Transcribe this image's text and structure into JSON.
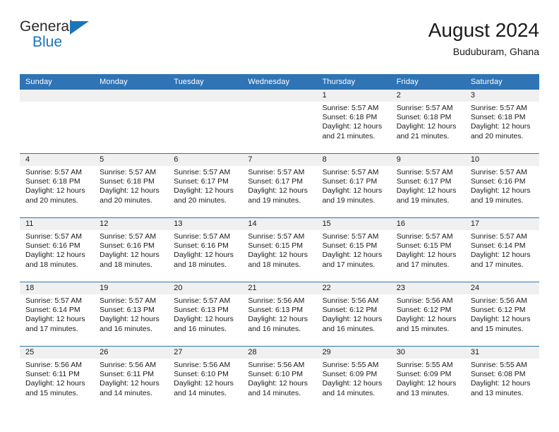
{
  "brand": {
    "name_part1": "General",
    "name_part2": "Blue",
    "flag_icon": "blue-triangle-flag",
    "colors": {
      "text": "#2b2b2b",
      "accent": "#1b75bb"
    }
  },
  "header": {
    "title": "August 2024",
    "subtitle": "Buduburam, Ghana"
  },
  "theme": {
    "header_blue": "#2f74b5",
    "daynum_band": "#f0f0f0",
    "cell_background": "#ffffff",
    "text": "#1a1a1a"
  },
  "calendar": {
    "weekday_headers": [
      "Sunday",
      "Monday",
      "Tuesday",
      "Wednesday",
      "Thursday",
      "Friday",
      "Saturday"
    ],
    "weeks": [
      [
        {
          "day": "",
          "empty": true,
          "sunrise": "",
          "sunset": "",
          "daylight_line1": "",
          "daylight_line2": ""
        },
        {
          "day": "",
          "empty": true,
          "sunrise": "",
          "sunset": "",
          "daylight_line1": "",
          "daylight_line2": ""
        },
        {
          "day": "",
          "empty": true,
          "sunrise": "",
          "sunset": "",
          "daylight_line1": "",
          "daylight_line2": ""
        },
        {
          "day": "",
          "empty": true,
          "sunrise": "",
          "sunset": "",
          "daylight_line1": "",
          "daylight_line2": ""
        },
        {
          "day": "1",
          "empty": false,
          "sunrise": "Sunrise: 5:57 AM",
          "sunset": "Sunset: 6:18 PM",
          "daylight_line1": "Daylight: 12 hours",
          "daylight_line2": "and 21 minutes."
        },
        {
          "day": "2",
          "empty": false,
          "sunrise": "Sunrise: 5:57 AM",
          "sunset": "Sunset: 6:18 PM",
          "daylight_line1": "Daylight: 12 hours",
          "daylight_line2": "and 21 minutes."
        },
        {
          "day": "3",
          "empty": false,
          "sunrise": "Sunrise: 5:57 AM",
          "sunset": "Sunset: 6:18 PM",
          "daylight_line1": "Daylight: 12 hours",
          "daylight_line2": "and 20 minutes."
        }
      ],
      [
        {
          "day": "4",
          "empty": false,
          "sunrise": "Sunrise: 5:57 AM",
          "sunset": "Sunset: 6:18 PM",
          "daylight_line1": "Daylight: 12 hours",
          "daylight_line2": "and 20 minutes."
        },
        {
          "day": "5",
          "empty": false,
          "sunrise": "Sunrise: 5:57 AM",
          "sunset": "Sunset: 6:18 PM",
          "daylight_line1": "Daylight: 12 hours",
          "daylight_line2": "and 20 minutes."
        },
        {
          "day": "6",
          "empty": false,
          "sunrise": "Sunrise: 5:57 AM",
          "sunset": "Sunset: 6:17 PM",
          "daylight_line1": "Daylight: 12 hours",
          "daylight_line2": "and 20 minutes."
        },
        {
          "day": "7",
          "empty": false,
          "sunrise": "Sunrise: 5:57 AM",
          "sunset": "Sunset: 6:17 PM",
          "daylight_line1": "Daylight: 12 hours",
          "daylight_line2": "and 19 minutes."
        },
        {
          "day": "8",
          "empty": false,
          "sunrise": "Sunrise: 5:57 AM",
          "sunset": "Sunset: 6:17 PM",
          "daylight_line1": "Daylight: 12 hours",
          "daylight_line2": "and 19 minutes."
        },
        {
          "day": "9",
          "empty": false,
          "sunrise": "Sunrise: 5:57 AM",
          "sunset": "Sunset: 6:17 PM",
          "daylight_line1": "Daylight: 12 hours",
          "daylight_line2": "and 19 minutes."
        },
        {
          "day": "10",
          "empty": false,
          "sunrise": "Sunrise: 5:57 AM",
          "sunset": "Sunset: 6:16 PM",
          "daylight_line1": "Daylight: 12 hours",
          "daylight_line2": "and 19 minutes."
        }
      ],
      [
        {
          "day": "11",
          "empty": false,
          "sunrise": "Sunrise: 5:57 AM",
          "sunset": "Sunset: 6:16 PM",
          "daylight_line1": "Daylight: 12 hours",
          "daylight_line2": "and 18 minutes."
        },
        {
          "day": "12",
          "empty": false,
          "sunrise": "Sunrise: 5:57 AM",
          "sunset": "Sunset: 6:16 PM",
          "daylight_line1": "Daylight: 12 hours",
          "daylight_line2": "and 18 minutes."
        },
        {
          "day": "13",
          "empty": false,
          "sunrise": "Sunrise: 5:57 AM",
          "sunset": "Sunset: 6:16 PM",
          "daylight_line1": "Daylight: 12 hours",
          "daylight_line2": "and 18 minutes."
        },
        {
          "day": "14",
          "empty": false,
          "sunrise": "Sunrise: 5:57 AM",
          "sunset": "Sunset: 6:15 PM",
          "daylight_line1": "Daylight: 12 hours",
          "daylight_line2": "and 18 minutes."
        },
        {
          "day": "15",
          "empty": false,
          "sunrise": "Sunrise: 5:57 AM",
          "sunset": "Sunset: 6:15 PM",
          "daylight_line1": "Daylight: 12 hours",
          "daylight_line2": "and 17 minutes."
        },
        {
          "day": "16",
          "empty": false,
          "sunrise": "Sunrise: 5:57 AM",
          "sunset": "Sunset: 6:15 PM",
          "daylight_line1": "Daylight: 12 hours",
          "daylight_line2": "and 17 minutes."
        },
        {
          "day": "17",
          "empty": false,
          "sunrise": "Sunrise: 5:57 AM",
          "sunset": "Sunset: 6:14 PM",
          "daylight_line1": "Daylight: 12 hours",
          "daylight_line2": "and 17 minutes."
        }
      ],
      [
        {
          "day": "18",
          "empty": false,
          "sunrise": "Sunrise: 5:57 AM",
          "sunset": "Sunset: 6:14 PM",
          "daylight_line1": "Daylight: 12 hours",
          "daylight_line2": "and 17 minutes."
        },
        {
          "day": "19",
          "empty": false,
          "sunrise": "Sunrise: 5:57 AM",
          "sunset": "Sunset: 6:13 PM",
          "daylight_line1": "Daylight: 12 hours",
          "daylight_line2": "and 16 minutes."
        },
        {
          "day": "20",
          "empty": false,
          "sunrise": "Sunrise: 5:57 AM",
          "sunset": "Sunset: 6:13 PM",
          "daylight_line1": "Daylight: 12 hours",
          "daylight_line2": "and 16 minutes."
        },
        {
          "day": "21",
          "empty": false,
          "sunrise": "Sunrise: 5:56 AM",
          "sunset": "Sunset: 6:13 PM",
          "daylight_line1": "Daylight: 12 hours",
          "daylight_line2": "and 16 minutes."
        },
        {
          "day": "22",
          "empty": false,
          "sunrise": "Sunrise: 5:56 AM",
          "sunset": "Sunset: 6:12 PM",
          "daylight_line1": "Daylight: 12 hours",
          "daylight_line2": "and 16 minutes."
        },
        {
          "day": "23",
          "empty": false,
          "sunrise": "Sunrise: 5:56 AM",
          "sunset": "Sunset: 6:12 PM",
          "daylight_line1": "Daylight: 12 hours",
          "daylight_line2": "and 15 minutes."
        },
        {
          "day": "24",
          "empty": false,
          "sunrise": "Sunrise: 5:56 AM",
          "sunset": "Sunset: 6:12 PM",
          "daylight_line1": "Daylight: 12 hours",
          "daylight_line2": "and 15 minutes."
        }
      ],
      [
        {
          "day": "25",
          "empty": false,
          "sunrise": "Sunrise: 5:56 AM",
          "sunset": "Sunset: 6:11 PM",
          "daylight_line1": "Daylight: 12 hours",
          "daylight_line2": "and 15 minutes."
        },
        {
          "day": "26",
          "empty": false,
          "sunrise": "Sunrise: 5:56 AM",
          "sunset": "Sunset: 6:11 PM",
          "daylight_line1": "Daylight: 12 hours",
          "daylight_line2": "and 14 minutes."
        },
        {
          "day": "27",
          "empty": false,
          "sunrise": "Sunrise: 5:56 AM",
          "sunset": "Sunset: 6:10 PM",
          "daylight_line1": "Daylight: 12 hours",
          "daylight_line2": "and 14 minutes."
        },
        {
          "day": "28",
          "empty": false,
          "sunrise": "Sunrise: 5:56 AM",
          "sunset": "Sunset: 6:10 PM",
          "daylight_line1": "Daylight: 12 hours",
          "daylight_line2": "and 14 minutes."
        },
        {
          "day": "29",
          "empty": false,
          "sunrise": "Sunrise: 5:55 AM",
          "sunset": "Sunset: 6:09 PM",
          "daylight_line1": "Daylight: 12 hours",
          "daylight_line2": "and 14 minutes."
        },
        {
          "day": "30",
          "empty": false,
          "sunrise": "Sunrise: 5:55 AM",
          "sunset": "Sunset: 6:09 PM",
          "daylight_line1": "Daylight: 12 hours",
          "daylight_line2": "and 13 minutes."
        },
        {
          "day": "31",
          "empty": false,
          "sunrise": "Sunrise: 5:55 AM",
          "sunset": "Sunset: 6:08 PM",
          "daylight_line1": "Daylight: 12 hours",
          "daylight_line2": "and 13 minutes."
        }
      ]
    ]
  }
}
